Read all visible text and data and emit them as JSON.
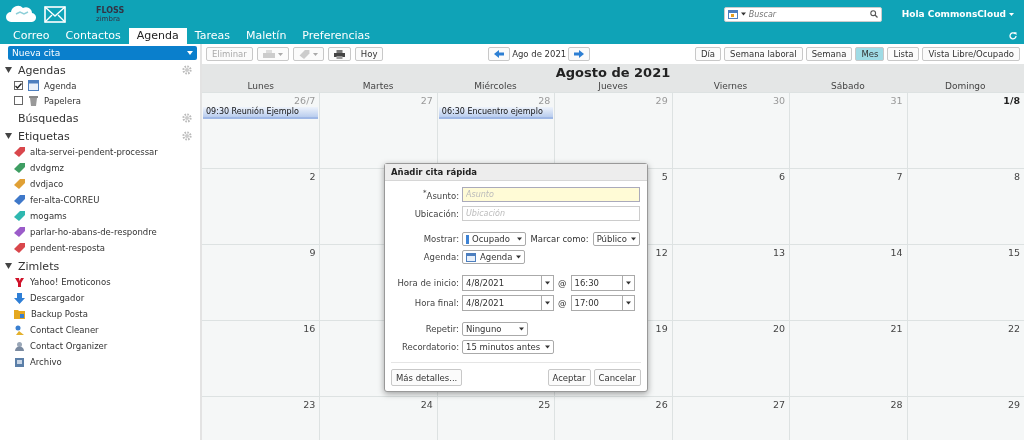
{
  "header": {
    "logo_text": "FLOSS",
    "logo_subtext": "zimbra",
    "search": {
      "placeholder": "Buscar"
    },
    "user_menu": "Hola CommonsCloud"
  },
  "tabs": [
    {
      "label": "Correo",
      "selected": false
    },
    {
      "label": "Contactos",
      "selected": false
    },
    {
      "label": "Agenda",
      "selected": true
    },
    {
      "label": "Tareas",
      "selected": false
    },
    {
      "label": "Maletín",
      "selected": false
    },
    {
      "label": "Preferencias",
      "selected": false
    }
  ],
  "new_button": "Nueva cita",
  "toolbar": {
    "delete": {
      "label": "Eliminar",
      "disabled": true
    },
    "today": "Hoy",
    "period": "Ago de 2021",
    "views": [
      {
        "label": "Día",
        "selected": false
      },
      {
        "label": "Semana laboral",
        "selected": false
      },
      {
        "label": "Semana",
        "selected": false
      },
      {
        "label": "Mes",
        "selected": true
      },
      {
        "label": "Lista",
        "selected": false
      },
      {
        "label": "Vista Libre/Ocupado",
        "selected": false
      }
    ]
  },
  "sidebar": {
    "sections": [
      {
        "title": "Agendas",
        "expanded": true,
        "settings": true,
        "items": [
          {
            "label": "Agenda",
            "checked": true
          },
          {
            "label": "Papelera",
            "checked": false
          }
        ]
      },
      {
        "title": "Búsquedas",
        "expanded": false,
        "settings": true
      },
      {
        "title": "Etiquetas",
        "expanded": true,
        "settings": true,
        "tags": [
          {
            "label": "alta-servei-pendent-processar",
            "color": "#d9474c"
          },
          {
            "label": "dvdgmz",
            "color": "#3f9e63"
          },
          {
            "label": "dvdjaco",
            "color": "#e0a035"
          },
          {
            "label": "fer-alta-CORREU",
            "color": "#3f78c9"
          },
          {
            "label": "mogams",
            "color": "#2fb8b0"
          },
          {
            "label": "parlar-ho-abans-de-respondre",
            "color": "#9b5cc9"
          },
          {
            "label": "pendent-resposta",
            "color": "#d9474c"
          }
        ]
      },
      {
        "title": "Zimlets",
        "expanded": true,
        "settings": false,
        "zimlets": [
          "Yahoo! Emoticonos",
          "Descargador",
          "Backup Posta",
          "Contact Cleaner",
          "Contact Organizer",
          "Archivo"
        ]
      }
    ]
  },
  "calendar": {
    "title": "Agosto de 2021",
    "weekdays": [
      "Lunes",
      "Martes",
      "Miércoles",
      "Jueves",
      "Viernes",
      "Sábado",
      "Domingo"
    ],
    "weeks": [
      {
        "cells": [
          {
            "day": "26/7",
            "other_month": true,
            "events": [
              "09:30 Reunión Ejemplo"
            ]
          },
          {
            "day": "27",
            "other_month": true
          },
          {
            "day": "28",
            "other_month": true,
            "events": [
              "06:30 Encuentro ejemplo"
            ]
          },
          {
            "day": "29",
            "other_month": true
          },
          {
            "day": "30",
            "other_month": true
          },
          {
            "day": "31",
            "other_month": true
          },
          {
            "day": "1/8",
            "other_month": false,
            "first": true
          }
        ]
      },
      {
        "cells": [
          {
            "day": "2",
            "other_month": false
          }
        ],
        "cells_right": [
          {
            "day": "5",
            "other_month": false
          },
          {
            "day": "6",
            "other_month": false
          },
          {
            "day": "7",
            "other_month": false
          },
          {
            "day": "8",
            "other_month": false
          }
        ]
      },
      {
        "cells": [
          {
            "day": "9",
            "other_month": false
          }
        ],
        "cells_right": [
          {
            "day": "12",
            "other_month": false
          },
          {
            "day": "13",
            "other_month": false
          },
          {
            "day": "14",
            "other_month": false
          },
          {
            "day": "15",
            "other_month": false
          }
        ]
      },
      {
        "cells": [
          {
            "day": "16",
            "other_month": false
          }
        ],
        "cells_right": [
          {
            "day": "19",
            "other_month": false
          },
          {
            "day": "20",
            "other_month": false
          },
          {
            "day": "21",
            "other_month": false
          },
          {
            "day": "22",
            "other_month": false
          }
        ]
      },
      {
        "cells": [
          {
            "day": "23",
            "other_month": false
          },
          {
            "day": "24",
            "other_month": false
          },
          {
            "day": "25",
            "other_month": false
          },
          {
            "day": "26",
            "other_month": false
          },
          {
            "day": "27",
            "other_month": false
          },
          {
            "day": "28",
            "other_month": false
          },
          {
            "day": "29",
            "other_month": false
          }
        ]
      }
    ]
  },
  "dialog": {
    "title": "Añadir cita rápida",
    "subject": {
      "label": "$^{*}$Asunto:",
      "placeholder": "Asunto"
    },
    "location": {
      "label": "Ubicación:",
      "placeholder": "Ubicación"
    },
    "show": {
      "label": "Mostrar:",
      "value": "Ocupado"
    },
    "mark_as": {
      "label": "Marcar como:",
      "value": "Público"
    },
    "calendar": {
      "label": "Agenda:",
      "value": "Agenda"
    },
    "start": {
      "label": "Hora de inicio:",
      "date": "4/8/2021",
      "at": "@",
      "time": "16:30"
    },
    "end": {
      "label": "Hora final:",
      "date": "4/8/2021",
      "at": "@",
      "time": "17:00"
    },
    "repeat": {
      "label": "Repetir:",
      "value": "Ninguno"
    },
    "reminder": {
      "label": "Recordatorio:",
      "value": "15 minutos antes"
    },
    "buttons": [
      "Más detalles...",
      "Aceptar",
      "Cancelar"
    ]
  }
}
